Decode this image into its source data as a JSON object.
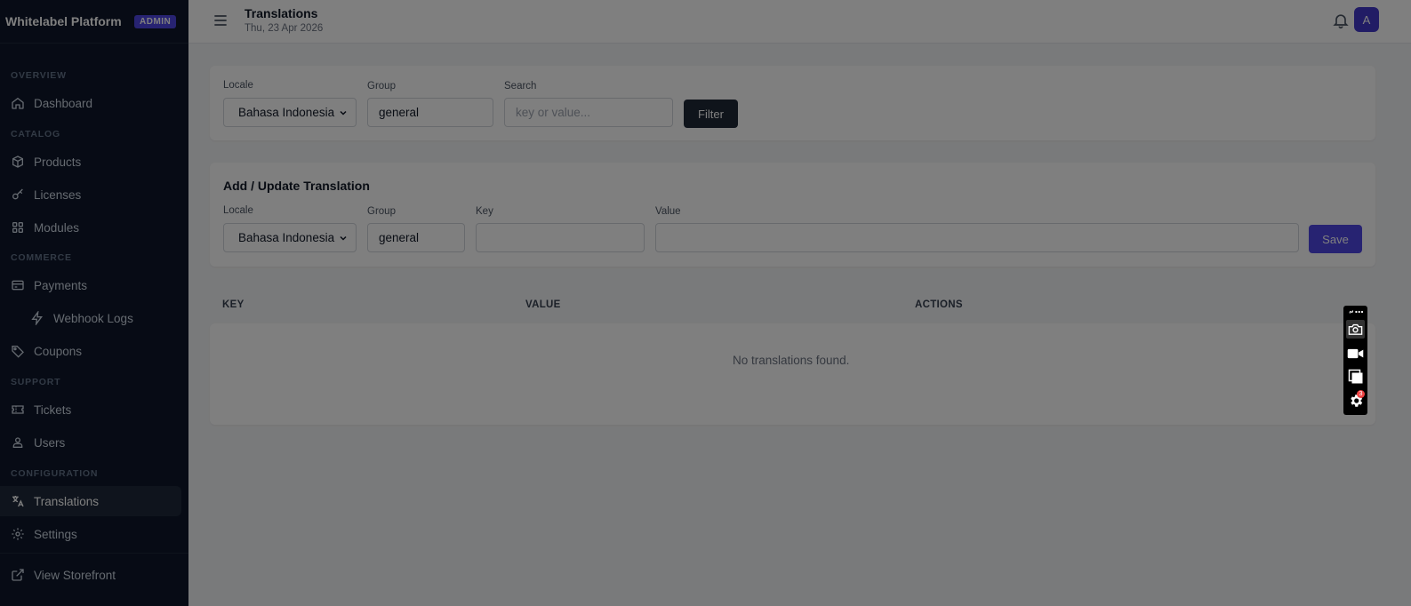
{
  "sidebar": {
    "brand": "Whitelabel Platform",
    "badge": "ADMIN",
    "sections": {
      "overview": "OVERVIEW",
      "catalog": "CATALOG",
      "commerce": "COMMERCE",
      "support": "SUPPORT",
      "configuration": "CONFIGURATION"
    },
    "items": {
      "dashboard": "Dashboard",
      "products": "Products",
      "licenses": "Licenses",
      "modules": "Modules",
      "payments": "Payments",
      "webhook_logs": "Webhook Logs",
      "coupons": "Coupons",
      "tickets": "Tickets",
      "users": "Users",
      "translations": "Translations",
      "settings": "Settings",
      "view_storefront": "View Storefront"
    },
    "active": "translations"
  },
  "header": {
    "title": "Translations",
    "date": "Thu, 23 Apr 2026",
    "avatar_initial": "A"
  },
  "filter": {
    "locale_label": "Locale",
    "locale_value": "Bahasa Indonesia",
    "group_label": "Group",
    "group_value": "general",
    "search_label": "Search",
    "search_placeholder": "key or value...",
    "button": "Filter"
  },
  "add_form": {
    "title": "Add / Update Translation",
    "locale_label": "Locale",
    "locale_value": "Bahasa Indonesia",
    "group_label": "Group",
    "group_value": "general",
    "key_label": "Key",
    "key_value": "",
    "value_label": "Value",
    "value_value": "",
    "button": "Save"
  },
  "table": {
    "columns": [
      "KEY",
      "VALUE",
      "ACTIONS"
    ],
    "empty_message": "No translations found."
  },
  "toolbar": {
    "badge_count": "3"
  },
  "colors": {
    "sidebar_bg": "#0f172a",
    "accent": "#4f46e5",
    "dark_button": "#1f2937",
    "overlay": "rgba(0,0,0,0.5)"
  }
}
